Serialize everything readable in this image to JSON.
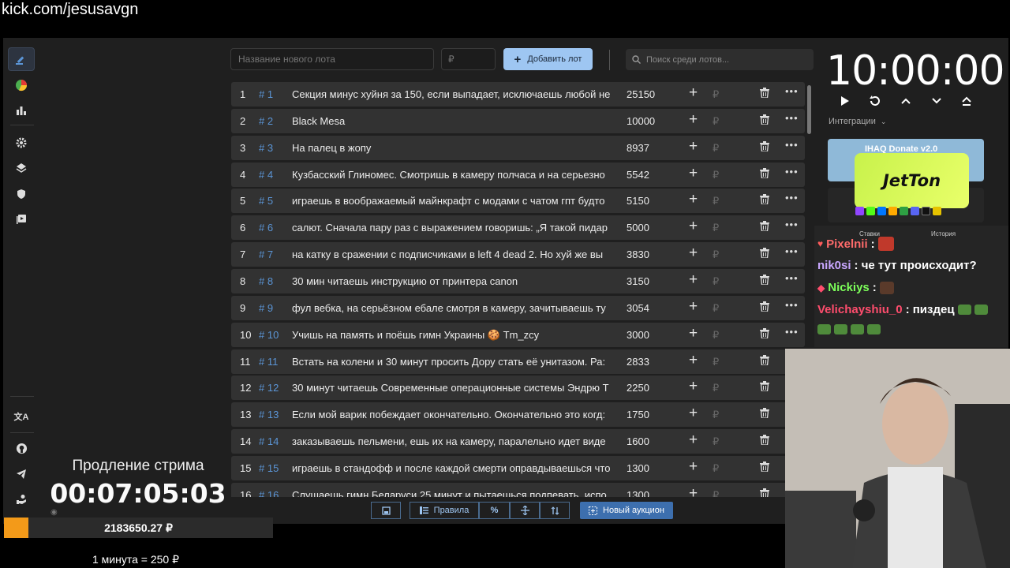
{
  "url_overlay": "kick.com/jesusavgn",
  "sidebar": {
    "icons": [
      "gavel-icon",
      "pie-chart-icon",
      "bar-chart-icon",
      "gear-icon",
      "layers-icon",
      "shield-icon",
      "video-library-icon",
      "translate-icon",
      "github-icon",
      "telegram-icon",
      "donation-hand-icon"
    ]
  },
  "top": {
    "lot_placeholder": "Название нового лота",
    "amount_placeholder": "₽",
    "add_button": "Добавить лот",
    "search_placeholder": "Поиск среди лотов..."
  },
  "lots": [
    {
      "n": "1",
      "id": "# 1",
      "name": "Секция минус хуйня за 150, если выпадает, исключаешь любой не",
      "amount": "25150"
    },
    {
      "n": "2",
      "id": "# 2",
      "name": "Black Mesa",
      "amount": "10000"
    },
    {
      "n": "3",
      "id": "# 3",
      "name": "На палец в жопу",
      "amount": "8937"
    },
    {
      "n": "4",
      "id": "# 4",
      "name": "Кузбасский Глиномес. Смотришь в камеру полчаса и на серьезно",
      "amount": "5542"
    },
    {
      "n": "5",
      "id": "# 5",
      "name": "играешь в воображаемый майнкрафт с модами с чатом гпт будто",
      "amount": "5150"
    },
    {
      "n": "6",
      "id": "# 6",
      "name": "салют. Сначала пару раз с выражением говоришь: „Я такой пидар",
      "amount": "5000"
    },
    {
      "n": "7",
      "id": "# 7",
      "name": "на катку в сражении с подписчиками в left 4 dead 2. Но хуй же вы",
      "amount": "3830"
    },
    {
      "n": "8",
      "id": "# 8",
      "name": "30 мин читаешь инструкцию от принтера canon",
      "amount": "3150"
    },
    {
      "n": "9",
      "id": "# 9",
      "name": "фул вебка, на серьёзном ебале смотря в камеру, зачитываешь ту",
      "amount": "3054"
    },
    {
      "n": "10",
      "id": "# 10",
      "name": "Учишь на память и поёшь гимн Украины 🍪 Tm_zcy",
      "amount": "3000"
    },
    {
      "n": "11",
      "id": "# 11",
      "name": "Встать на колени и 30 минут просить Дору стать её унитазом. Ра:",
      "amount": "2833"
    },
    {
      "n": "12",
      "id": "# 12",
      "name": "30 минут читаешь Современные операционные системы Эндрю Т",
      "amount": "2250"
    },
    {
      "n": "13",
      "id": "# 13",
      "name": "Если мой варик побеждает окончательно. Окончательно это когд:",
      "amount": "1750"
    },
    {
      "n": "14",
      "id": "# 14",
      "name": "заказываешь пельмени, ешь их на камеру, паралельно идет виде",
      "amount": "1600"
    },
    {
      "n": "15",
      "id": "# 15",
      "name": "играешь в стандофф и после каждой смерти оправдываешься что",
      "amount": "1300"
    },
    {
      "n": "16",
      "id": "# 16",
      "name": "Слушаешь гимн Беларуси 25 минут и пытаешься подпевать, испо",
      "amount": "1300"
    }
  ],
  "row_currency": "₽",
  "toolbar": {
    "rules": "Правила",
    "percent": "%",
    "new_auction": "Новый аукцион"
  },
  "extension": {
    "title": "Продление стрима",
    "timer": "00:07:05:03"
  },
  "balance": {
    "text": "2183650.27 ₽",
    "fill_fraction": 0.09
  },
  "rate": "1 минута = 250 ₽",
  "timer": "10:00:00",
  "integrations_label": "Интеграции",
  "integration_card": "IHAQ Donate v2.0",
  "jetton": "JetTon",
  "chat": {
    "tabs": [
      "Ставки",
      "История"
    ],
    "messages": [
      {
        "user": "Pixelnii",
        "color": "#ff6b6b",
        "text": ":"
      },
      {
        "user": "nik0si",
        "color": "#c9a7ff",
        "text": ": че тут происходит?"
      },
      {
        "user": "Nickiys",
        "color": "#7dff5a",
        "text": ":"
      },
      {
        "user": "Velichayshiu_0",
        "color": "#ff4d6d",
        "text": ": пиздец"
      }
    ]
  },
  "colors": {
    "accent": "#9ec6f2",
    "link": "#5b95d6",
    "balance_fill": "#f39a19",
    "new_auction": "#3d6fae"
  }
}
